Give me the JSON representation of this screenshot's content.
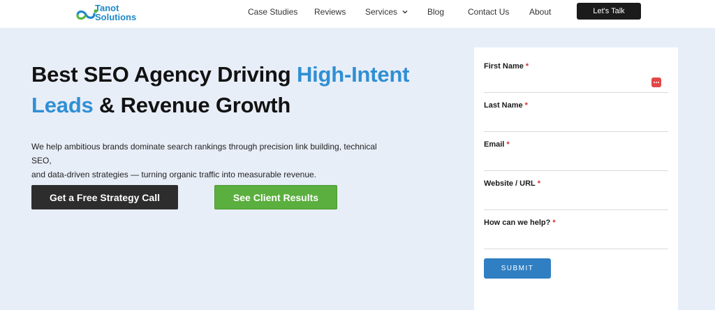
{
  "brand": {
    "line1": "Tanot",
    "line2": "Solutions",
    "colors": {
      "primary": "#1e88c8",
      "secondary": "#55b83c"
    }
  },
  "nav": {
    "items": [
      {
        "label": "Case Studies"
      },
      {
        "label": "Reviews"
      },
      {
        "label": "Services"
      },
      {
        "label": "Blog"
      },
      {
        "label": "Contact Us"
      },
      {
        "label": "About"
      }
    ],
    "cta_label": "Let's Talk"
  },
  "hero": {
    "title_part1": "Best SEO Agency Driving ",
    "title_accent1": "High-Intent",
    "title_accent2": "Leads",
    "title_part2": " & Revenue Growth",
    "description_line1": "We help ambitious brands dominate search rankings through precision link building, technical SEO,",
    "description_line2": "and data-driven strategies — turning organic traffic into measurable revenue.",
    "primary_button": "Get a Free Strategy Call",
    "secondary_button": "See Client Results",
    "accent_color": "#2f8fd4"
  },
  "form": {
    "fields": [
      {
        "label": "First Name",
        "required_mark": "*",
        "value": ""
      },
      {
        "label": "Last Name",
        "required_mark": "*",
        "value": ""
      },
      {
        "label": "Email",
        "required_mark": "*",
        "value": ""
      },
      {
        "label": "Website / URL",
        "required_mark": "*",
        "value": ""
      },
      {
        "label": "How can we help?",
        "required_mark": "*",
        "value": ""
      }
    ],
    "submit_label": "SUBMIT"
  }
}
